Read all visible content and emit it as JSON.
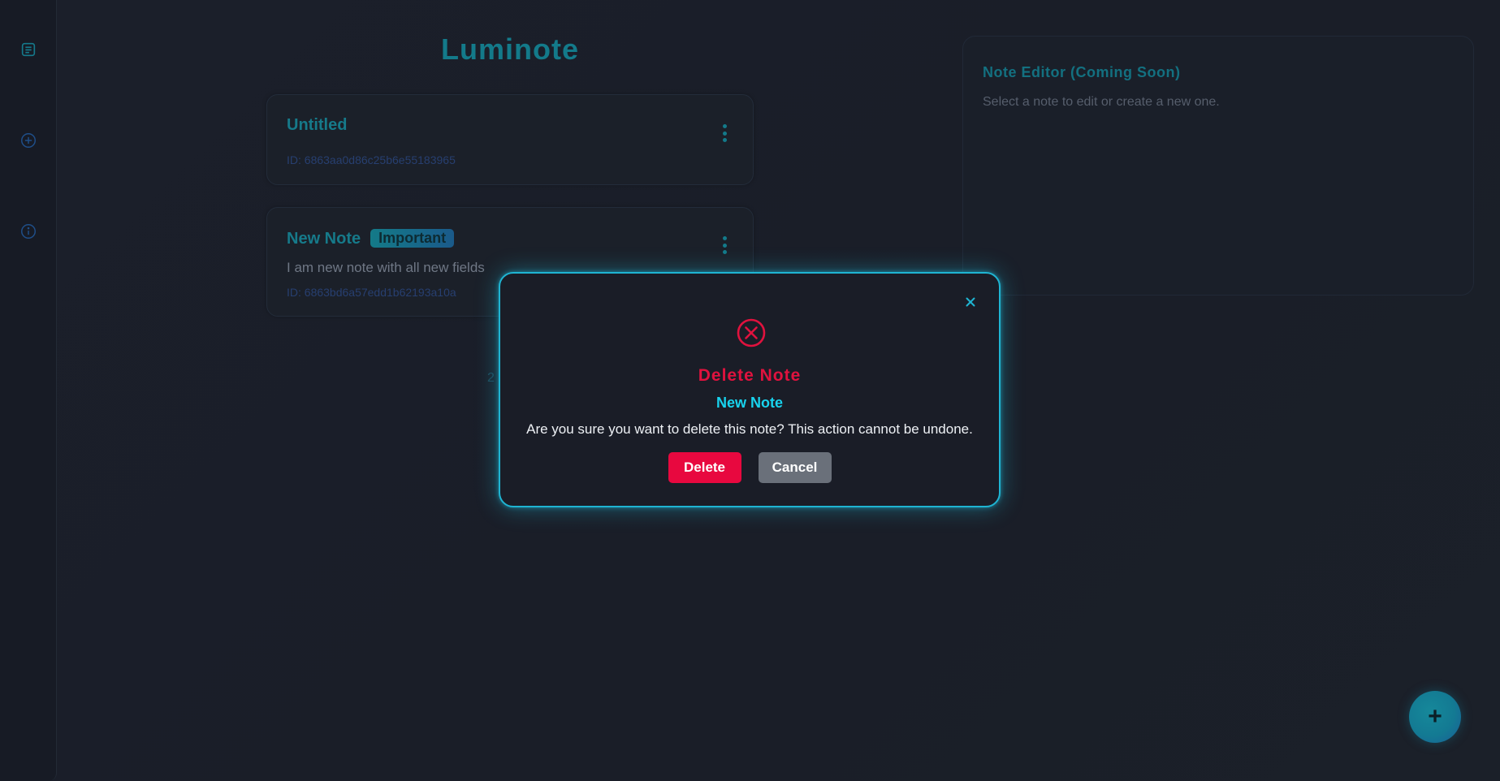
{
  "app": {
    "title": "Luminote"
  },
  "sidebar": {
    "items": [
      {
        "icon": "notes-icon"
      },
      {
        "icon": "add-circle-icon"
      },
      {
        "icon": "info-icon"
      }
    ]
  },
  "notes": [
    {
      "title": "Untitled",
      "badge": "",
      "body": "",
      "id_text": "ID: 6863aa0d86c25b6e55183965"
    },
    {
      "title": "New Note",
      "badge": "Important",
      "body": "I am new note with all new fields",
      "id_text": "ID: 6863bd6a57edd1b62193a10a"
    }
  ],
  "pager": {
    "number": "2"
  },
  "editor": {
    "title": "Note Editor (Coming Soon)",
    "hint": "Select a note to edit or create a new one."
  },
  "fab": {
    "label": "+"
  },
  "modal": {
    "title": "Delete Note",
    "note_title": "New Note",
    "message": "Are you sure you want to delete this note? This action cannot be undone.",
    "delete_label": "Delete",
    "cancel_label": "Cancel",
    "close_label": "×"
  },
  "colors": {
    "accent": "#137a8a",
    "danger": "#e0123e",
    "modal_border": "#1fb4d2",
    "cyan_text": "#18d3ee",
    "cancel_gray": "#6a707a"
  }
}
